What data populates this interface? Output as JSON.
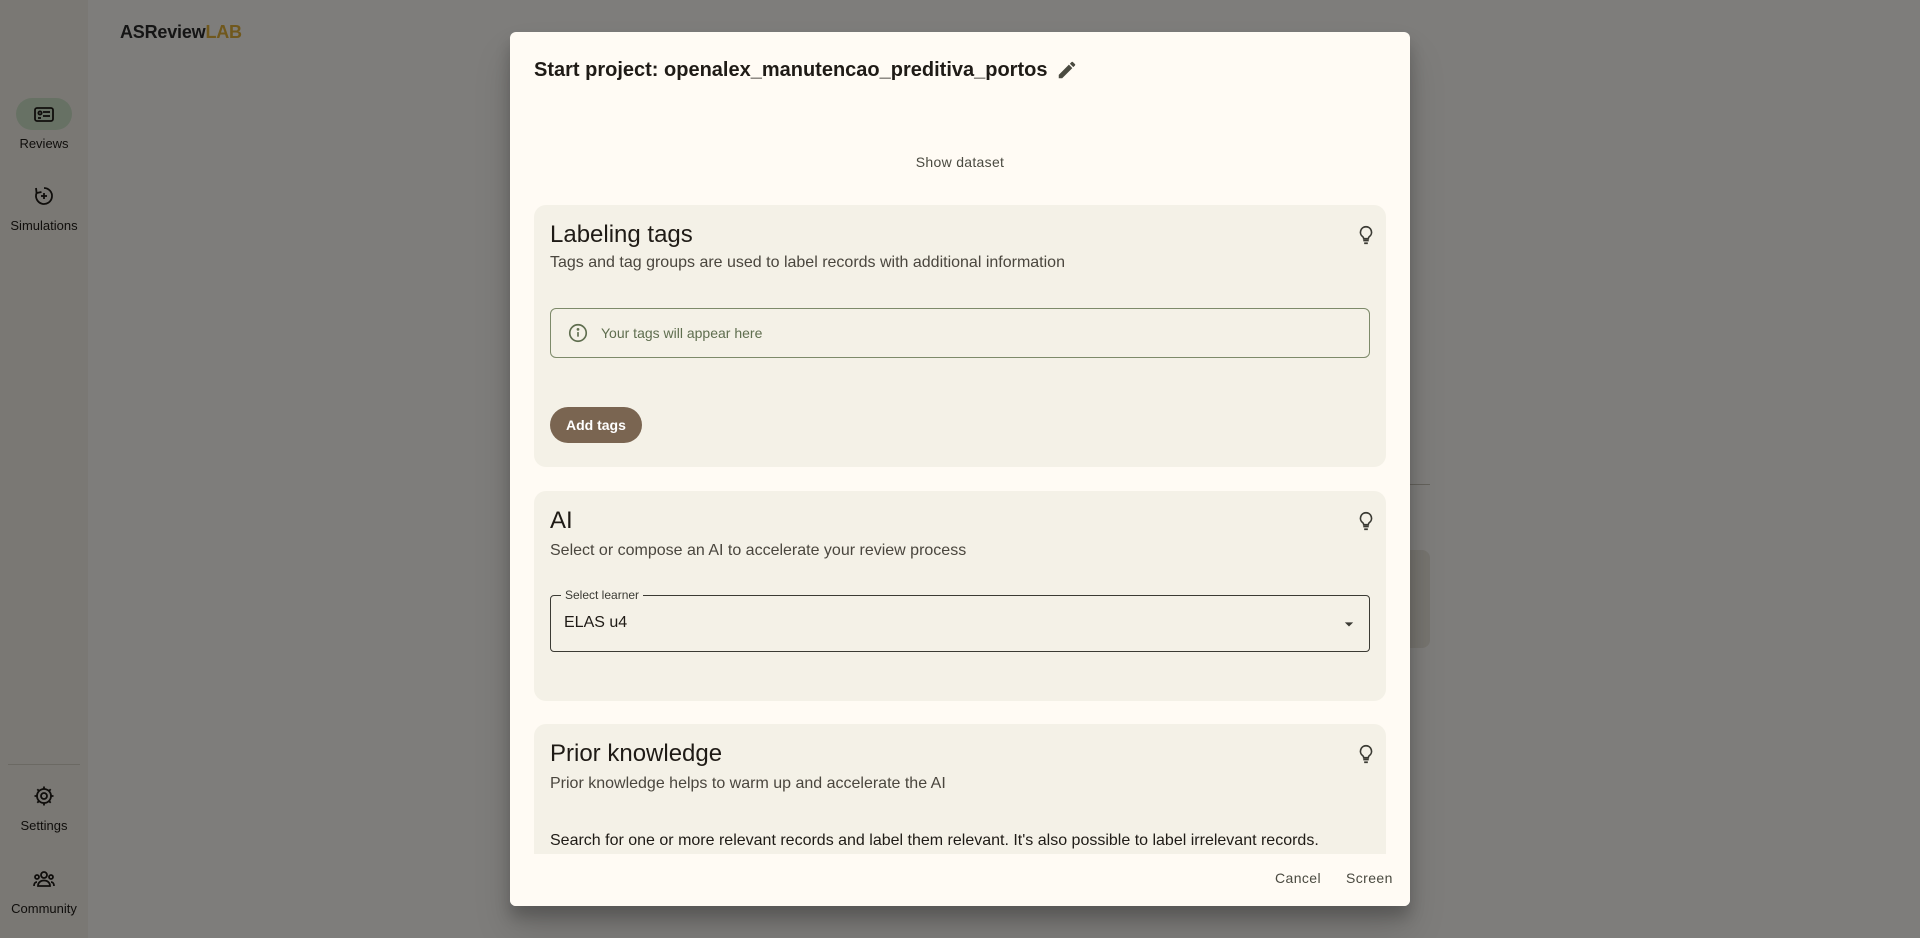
{
  "app": {
    "logo_main": "ASReview",
    "logo_accent": "LAB",
    "nav": {
      "reviews": "Reviews",
      "simulations": "Simulations",
      "settings": "Settings",
      "community": "Community"
    }
  },
  "dialog": {
    "title": "Start project: openalex_manutencao_preditiva_portos",
    "show_dataset": "Show dataset",
    "tags": {
      "title": "Labeling tags",
      "subtitle": "Tags and tag groups are used to label records with additional information",
      "empty_text": "Your tags will appear here",
      "add_button": "Add tags"
    },
    "ai": {
      "title": "AI",
      "subtitle": "Select or compose an AI to accelerate your review process",
      "select_label": "Select learner",
      "select_value": "ELAS u4"
    },
    "prior": {
      "title": "Prior knowledge",
      "subtitle": "Prior knowledge helps to warm up and accelerate the AI",
      "body": "Search for one or more relevant records and label them relevant. It's also possible to label irrelevant records."
    },
    "actions": {
      "cancel": "Cancel",
      "screen": "Screen"
    }
  },
  "colors": {
    "accent_button": "#7a6551",
    "active_nav": "#cfe3c8",
    "card_bg": "#f4f1e7"
  }
}
